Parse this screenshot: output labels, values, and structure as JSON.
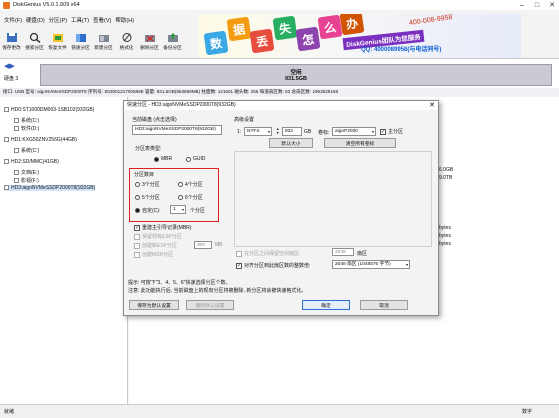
{
  "window": {
    "title": "DiskGenius V5.0.1.609 x64",
    "colors": {
      "accent": "#e02020",
      "disk_bar": "#c9cad2"
    }
  },
  "menu": [
    "文件(F)",
    "硬盘(D)",
    "分区(P)",
    "工具(T)",
    "查看(V)",
    "帮助(H)"
  ],
  "toolbar": [
    {
      "label": "保存更改",
      "icon": "save-icon"
    },
    {
      "label": "搜索分区",
      "icon": "search-icon"
    },
    {
      "label": "恢复文件",
      "icon": "recover-files-icon"
    },
    {
      "label": "快速分区",
      "icon": "quick-partition-icon"
    },
    {
      "label": "新建分区",
      "icon": "new-partition-icon"
    },
    {
      "label": "格式化",
      "icon": "format-icon"
    },
    {
      "label": "删除分区",
      "icon": "delete-partition-icon"
    },
    {
      "label": "备份分区",
      "icon": "backup-partition-icon"
    }
  ],
  "banner": {
    "tiles": [
      "数",
      "据",
      "丢",
      "失",
      "怎",
      "么",
      "办"
    ],
    "team": "DiskGenius团队为您服务",
    "qq": "QQ: 4000089958(与电话同号)",
    "phone": "400-008-9958"
  },
  "disk": {
    "label": "硬盘 3",
    "free_label": "空闲",
    "free_size": "931.5GB",
    "info": "接口: USB  型号: aigoNVMeSSDP2000T8  序列号: S0300121700588E  容量: 931.5GB(953869MB)  柱面数: 121601  磁头数: 255  每道扇区数: 63  总扇区数: 1953525168"
  },
  "tree": {
    "rows": [
      "HD0:ST1000DM003-1SB102(932GB)",
      "系统(C:)",
      "软件(D:)",
      "HD1:KXG50ZNV256G(44GB)",
      "系统(C:)",
      "HD2:SD/MMC(41GB)",
      "文档(E:)",
      "影视(F:)",
      "HD3:aigoNVMeSSDP2000T8(932GB)"
    ]
  },
  "right": {
    "snippets": [
      "6.0GB",
      "9.0TB",
      "bytes",
      "bytes",
      "bytes"
    ]
  },
  "status": {
    "left": "就绪",
    "right": "数字"
  },
  "dialog": {
    "title": "快速分区 - HD3:aigoNVMeSSDP2000T8(932GB)",
    "current_disk_label": "当前磁盘 (点击选择)",
    "current_disk_value": "HD3:aigoNVMeSSDP2000T8(932GB)",
    "partition_table_label": "分区表类型:",
    "table_types": [
      "MBR",
      "GUID"
    ],
    "table_selected": "MBR",
    "count_label": "分区数目",
    "counts": [
      "3个分区",
      "4个分区",
      "5个分区",
      "6个分区"
    ],
    "custom_label": "自定(C):",
    "custom_value": "1",
    "custom_unit": "个分区",
    "rebuild_mbr": "重建主引导记录(MBR)",
    "keep_esp": "保留现有ESP分区",
    "create_esp": "创建新ESP分区",
    "esp_size": "300",
    "esp_unit": "MB",
    "create_msr": "创建MSR分区",
    "advanced_label": "高级设置",
    "row_index": "1:",
    "fs": "NTFS",
    "size": "932",
    "size_unit": "GB",
    "vol_label": "卷标:",
    "vol_value": "aigoP2000",
    "primary_label": "主分区",
    "default_size_btn": "默认大小",
    "clear_labels_btn": "清空所有卷标",
    "gap_label": "在分区之间保留空闲扇区:",
    "gap_value": "2048",
    "gap_unit": "扇区",
    "align_label": "对齐分区到此扇区数的整数倍:",
    "align_value": "2048 扇区 (1048576 字节)",
    "hint1": "提示: 可按下\"3、4、5、6\"快速选择分区个数。",
    "hint2": "注意: 此功能执行后, 当前磁盘上的现有分区将被删除, 新分区将会被快速格式化。",
    "save_default_btn": "保存为默认设置",
    "delete_default_btn": "删除默认设置",
    "ok_btn": "确定",
    "cancel_btn": "取消"
  }
}
